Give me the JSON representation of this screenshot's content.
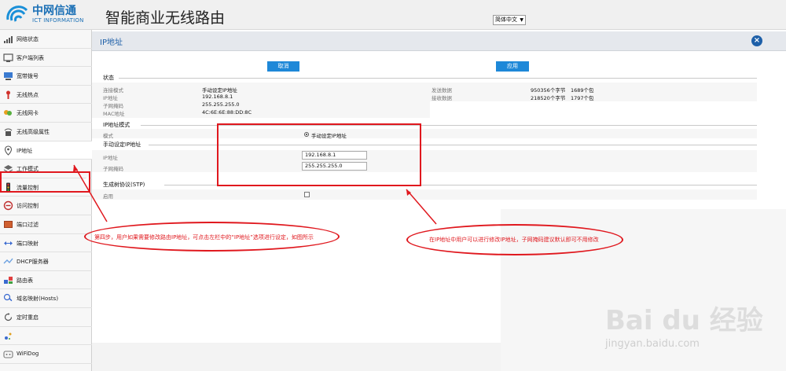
{
  "header": {
    "logo_cn": "中网信通",
    "logo_en": "ICT INFORMATION",
    "title": "智能商业无线路由",
    "language": "简体中文"
  },
  "sidebar": {
    "items": [
      {
        "label": "网络状态",
        "icon": "signal-icon"
      },
      {
        "label": "客户端列表",
        "icon": "client-list-icon"
      },
      {
        "label": "宽带拨号",
        "icon": "broadband-icon"
      },
      {
        "label": "无线热点",
        "icon": "hotspot-icon"
      },
      {
        "label": "无线网卡",
        "icon": "wireless-card-icon"
      },
      {
        "label": "无线高级属性",
        "icon": "wifi-advanced-icon"
      },
      {
        "label": "IP地址",
        "icon": "location-pin-icon"
      },
      {
        "label": "工作模式",
        "icon": "layers-icon"
      },
      {
        "label": "流量控制",
        "icon": "traffic-light-icon"
      },
      {
        "label": "访问控制",
        "icon": "access-control-icon"
      },
      {
        "label": "端口过滤",
        "icon": "port-filter-icon"
      },
      {
        "label": "端口映射",
        "icon": "port-map-icon"
      },
      {
        "label": "DHCP服务器",
        "icon": "dhcp-icon"
      },
      {
        "label": "路由表",
        "icon": "route-table-icon"
      },
      {
        "label": "域名映射(Hosts)",
        "icon": "dns-icon"
      },
      {
        "label": "定时重启",
        "icon": "timer-restart-icon"
      },
      {
        "label": "",
        "icon": "plugin-icon"
      },
      {
        "label": "WiFiDog",
        "icon": "wifidog-icon"
      }
    ],
    "active_index": 6
  },
  "panel": {
    "title": "IP地址",
    "cancel_label": "取消",
    "apply_label": "应用",
    "status": {
      "section": "状态",
      "conn_mode_label": "连接模式",
      "conn_mode_value": "手动设定IP地址",
      "ip_label": "IP地址",
      "ip_value": "192.168.8.1",
      "mask_label": "子网掩码",
      "mask_value": "255.255.255.0",
      "mac_label": "MAC地址",
      "mac_value": "4C:6E:6E:88:DD:8C",
      "sent_label": "发送数据",
      "sent_bytes": "950356个字节",
      "sent_packets": "1689个包",
      "recv_label": "接收数据",
      "recv_bytes": "218520个字节",
      "recv_packets": "1797个包"
    },
    "ip_mode": {
      "section": "IP地址模式",
      "mode_label": "模式",
      "mode_value": "手动设定IP地址"
    },
    "manual_ip": {
      "section": "手动设定IP地址",
      "ip_label": "IP地址",
      "ip_value": "192.168.8.1",
      "mask_label": "子网掩码",
      "mask_value": "255.255.255.0"
    },
    "stp": {
      "section": "生成树协议(STP)",
      "enable_label": "启用",
      "enabled": false
    }
  },
  "annotations": {
    "left_note": "第四步，用户如果需要修改路由IP地址，可点击左栏中的“IP地址”选项进行设定，如图所示",
    "right_note": "在IP地址中用户可以进行修改IP地址，子网掩码建议默认即可不用修改"
  },
  "watermark": {
    "brand": "Bai du 经验",
    "url": "jingyan.baidu.com"
  },
  "colors": {
    "accent": "#1e88d8",
    "title_blue": "#1d5fa8",
    "annotation_red": "#e0181e"
  }
}
